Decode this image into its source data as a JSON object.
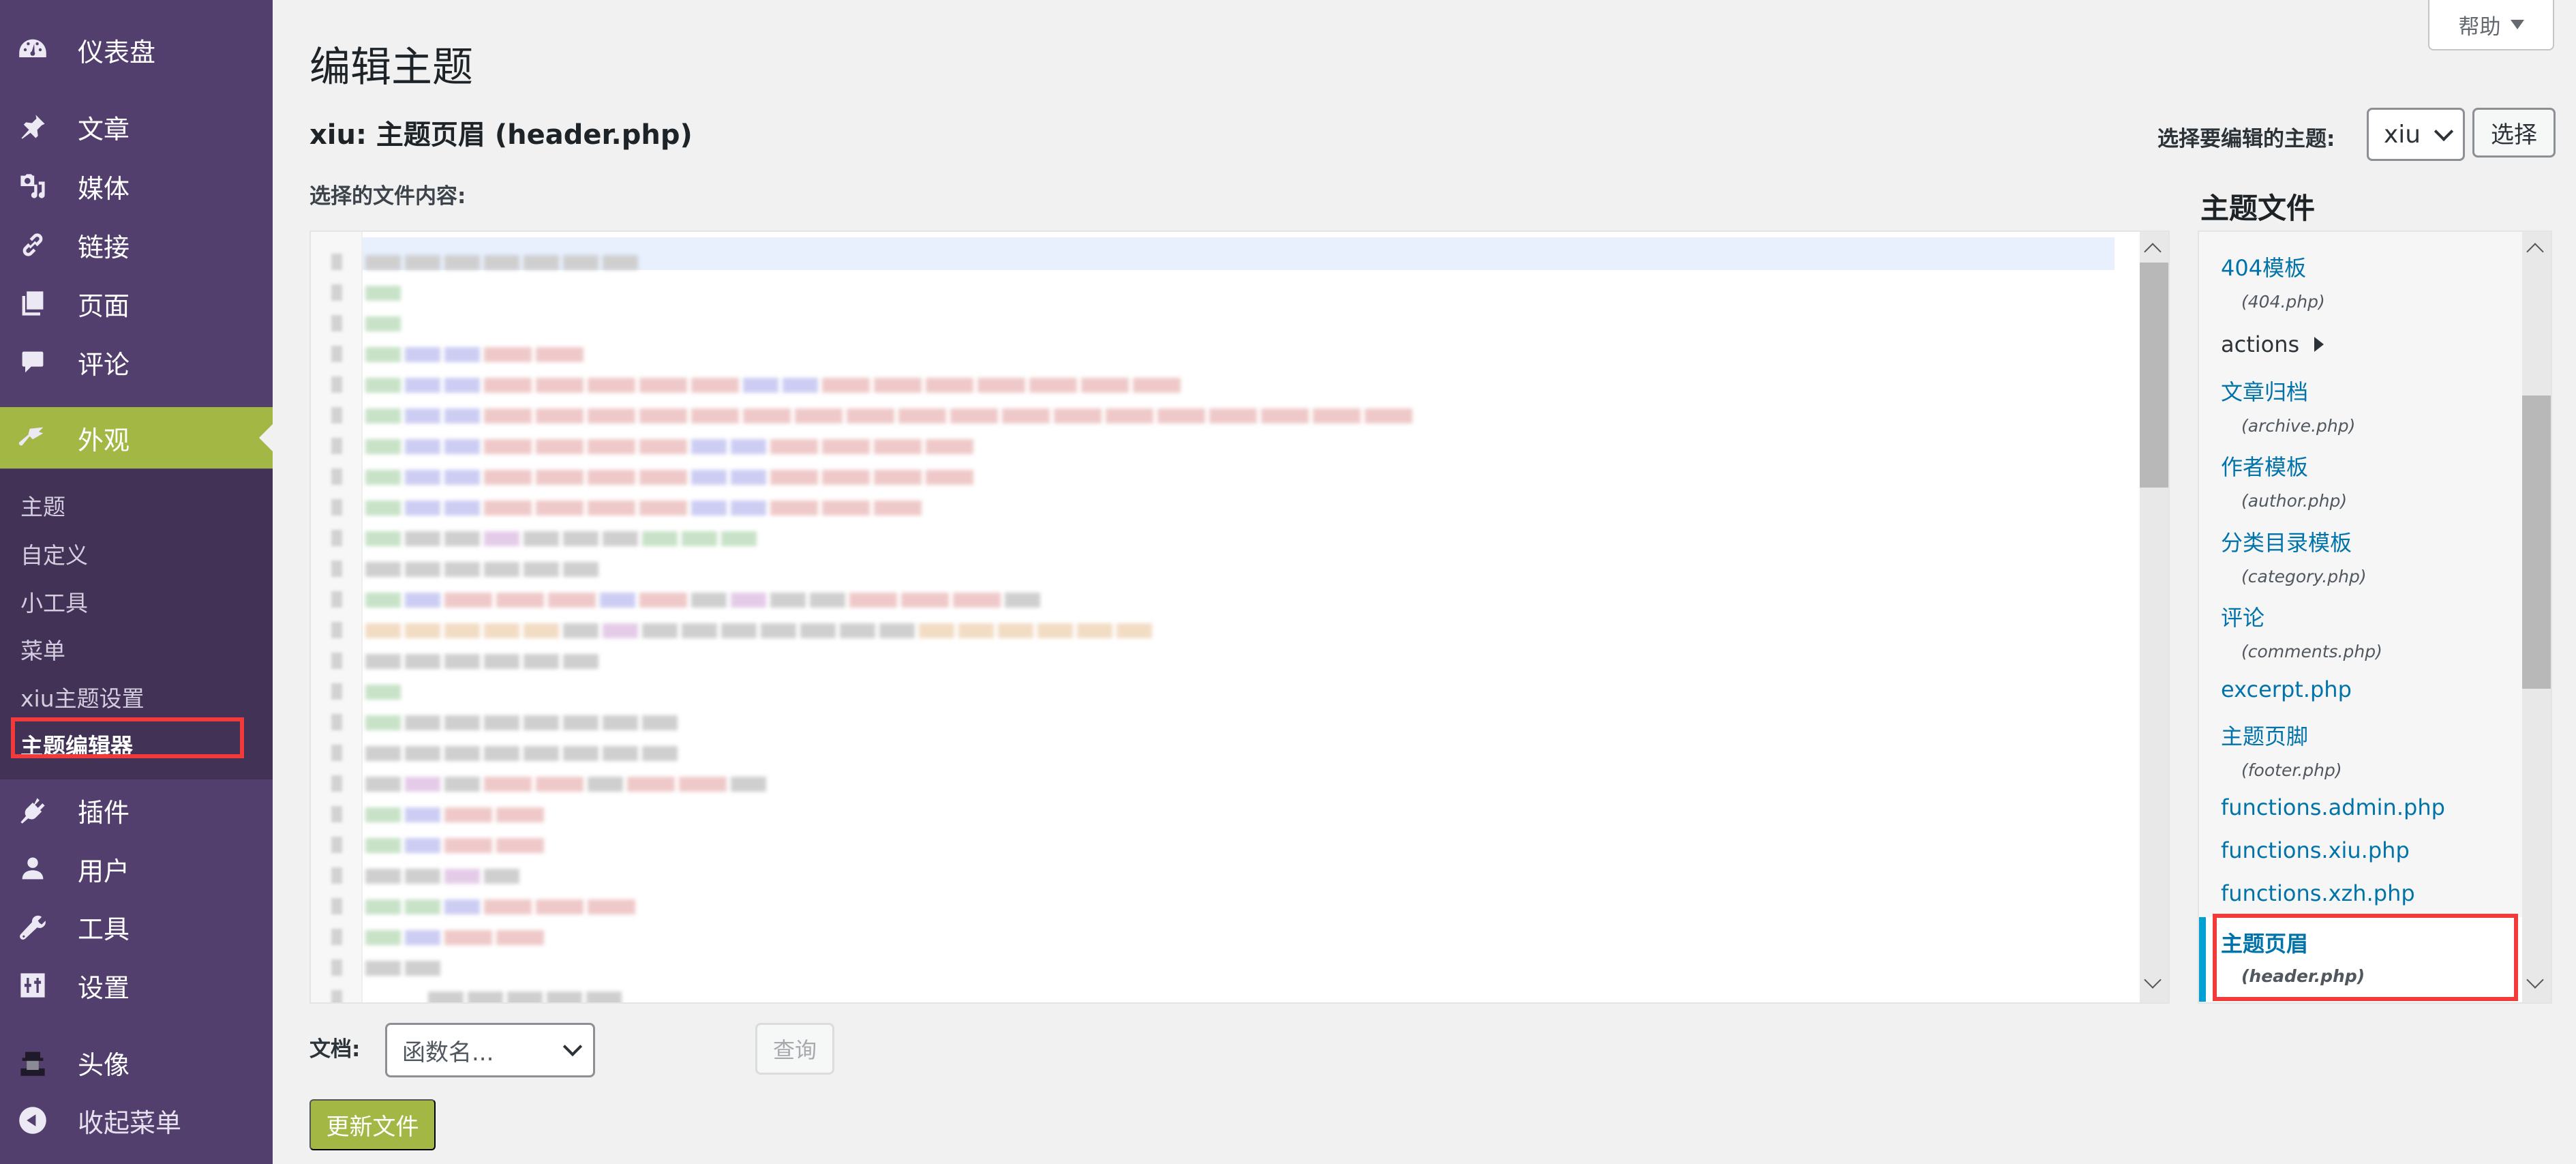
{
  "sidebar": {
    "menu": [
      {
        "label": "仪表盘",
        "icon": "dashboard-icon"
      },
      {
        "label": "文章",
        "icon": "pin-icon"
      },
      {
        "label": "媒体",
        "icon": "media-icon"
      },
      {
        "label": "链接",
        "icon": "link-icon"
      },
      {
        "label": "页面",
        "icon": "pages-icon"
      },
      {
        "label": "评论",
        "icon": "comment-icon"
      },
      {
        "label": "外观",
        "icon": "appearance-brush-icon",
        "active": true
      },
      {
        "label": "插件",
        "icon": "plugin-icon"
      },
      {
        "label": "用户",
        "icon": "user-icon"
      },
      {
        "label": "工具",
        "icon": "wrench-icon"
      },
      {
        "label": "设置",
        "icon": "settings-sliders-icon"
      },
      {
        "label": "头像",
        "icon": "avatar-icon"
      },
      {
        "label": "收起菜单",
        "icon": "collapse-arrow-icon"
      }
    ],
    "submenu": [
      {
        "label": "主题"
      },
      {
        "label": "自定义"
      },
      {
        "label": "小工具"
      },
      {
        "label": "菜单"
      },
      {
        "label": "xiu主题设置"
      },
      {
        "label": "主题编辑器",
        "current": true
      }
    ]
  },
  "header": {
    "help_label": "帮助",
    "page_title": "编辑主题",
    "file_heading_prefix": "xiu: ",
    "file_heading_name": "主题页眉",
    "file_heading_file": " (header.php)",
    "content_label": "选择的文件内容:"
  },
  "theme_selector": {
    "label": "选择要编辑的主题:",
    "selected": "xiu",
    "button_label": "选择"
  },
  "theme_files": {
    "title": "主题文件",
    "items": [
      {
        "name": "404模板",
        "file": "(404.php)"
      },
      {
        "folder": "actions"
      },
      {
        "name": "文章归档",
        "file": "(archive.php)"
      },
      {
        "name": "作者模板",
        "file": "(author.php)"
      },
      {
        "name": "分类目录模板",
        "file": "(category.php)"
      },
      {
        "name": "评论",
        "file": "(comments.php)"
      },
      {
        "name": "excerpt.php"
      },
      {
        "name": "主题页脚",
        "file": "(footer.php)"
      },
      {
        "name": "functions.admin.php"
      },
      {
        "name": "functions.xiu.php"
      },
      {
        "name": "functions.xzh.php"
      }
    ],
    "current": {
      "name": "主题页眉",
      "file": "(header.php)"
    }
  },
  "documentation": {
    "label": "文档:",
    "placeholder": "函数名...",
    "lookup_label": "查询"
  },
  "update_button_label": "更新文件",
  "colors": {
    "sidebar_bg": "#523f6d",
    "submenu_bg": "#413256",
    "accent_green": "#a3b745",
    "link_blue": "#0073aa",
    "current_file_marker": "#00a0d2",
    "highlight_red": "#f23a3a"
  }
}
